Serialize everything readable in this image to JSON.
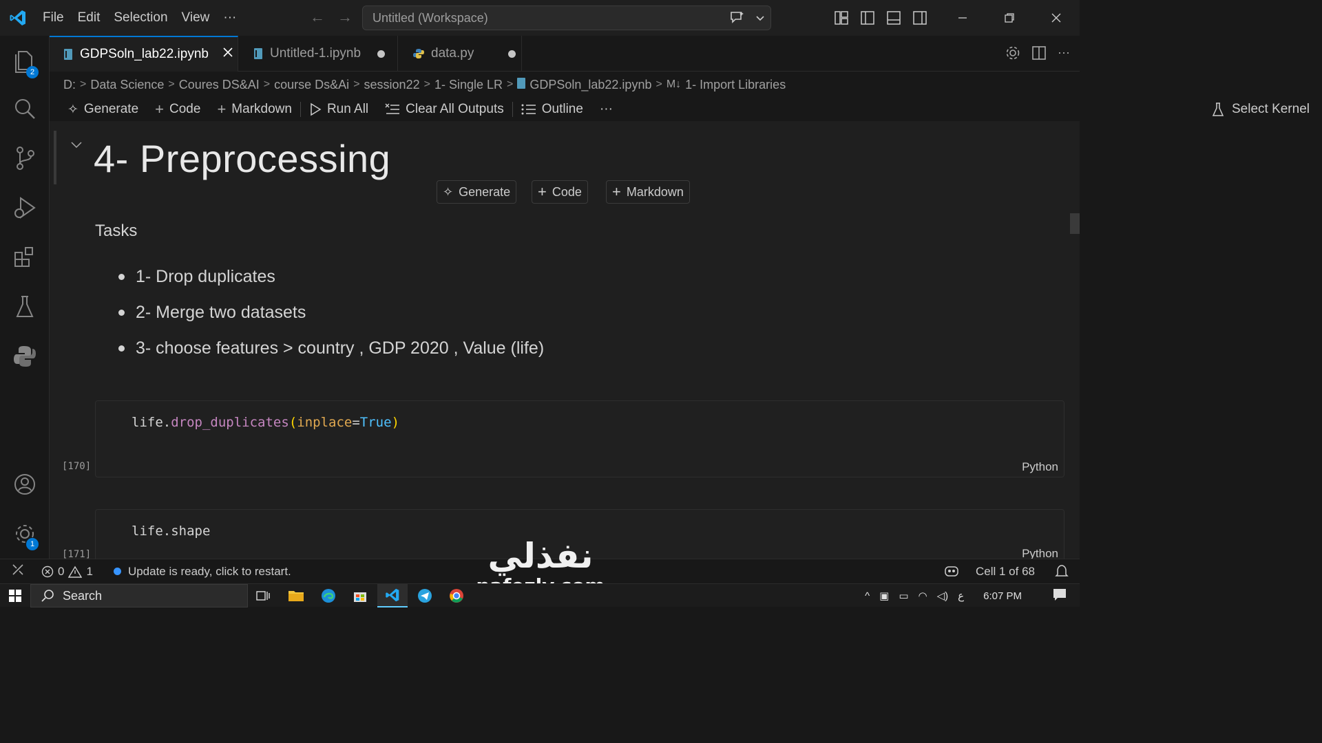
{
  "titlebar": {
    "menu": [
      "File",
      "Edit",
      "Selection",
      "View",
      "···"
    ],
    "command_center": "Untitled (Workspace)",
    "accent": "#0078d4"
  },
  "activity_bar": {
    "items": [
      "explorer-icon",
      "search-icon",
      "source-control-icon",
      "run-debug-icon",
      "extensions-icon",
      "testing-icon",
      "python-icon",
      "account-icon",
      "manage-gear-icon"
    ],
    "explorer_badge": "2",
    "manage_badge": "1"
  },
  "tabs": [
    {
      "label": "GDPSoln_lab22.ipynb",
      "active": true
    },
    {
      "label": "Untitled-1.ipynb",
      "active": false
    },
    {
      "label": "data.py",
      "active": false
    }
  ],
  "breadcrumb": [
    "D:",
    "Data Science",
    "Coures DS&AI",
    "course Ds&Ai",
    "session22",
    "1- Single LR",
    "GDPSoln_lab22.ipynb",
    "1- Import Libraries"
  ],
  "notebook_toolbar": {
    "generate": "Generate",
    "code": "Code",
    "markdown": "Markdown",
    "run_all": "Run All",
    "clear_outputs": "Clear All Outputs",
    "outline": "Outline",
    "more": "···",
    "select_kernel": "Select Kernel"
  },
  "markdown_cell": {
    "heading": "4- Preprocessing",
    "insert_generate": "Generate",
    "insert_code": "Code",
    "insert_markdown": "Markdown",
    "tasks_title": "Tasks",
    "tasks": [
      "1- Drop duplicates",
      "2- Merge two datasets",
      "3- choose features > country , GDP 2020 , Value (life)"
    ]
  },
  "code_cells": [
    {
      "count": "[170]",
      "language": "Python",
      "tokens": {
        "obj": "life",
        "dot": ".",
        "fn": "drop_duplicates",
        "lp": "(",
        "arg": "inplace",
        "eq": "=",
        "val": "True",
        "rp": ")"
      }
    },
    {
      "count": "[171]",
      "language": "Python",
      "code": "life.shape"
    }
  ],
  "status_bar": {
    "errors": "0",
    "warnings": "1",
    "update_msg": "Update is ready, click to restart.",
    "cell_pos": "Cell 1 of 68"
  },
  "taskbar": {
    "search": "Search",
    "lang": "ع",
    "time": "6:07 PM"
  },
  "watermark": {
    "arabic": "نفذلي",
    "site": "nafezly.com"
  }
}
